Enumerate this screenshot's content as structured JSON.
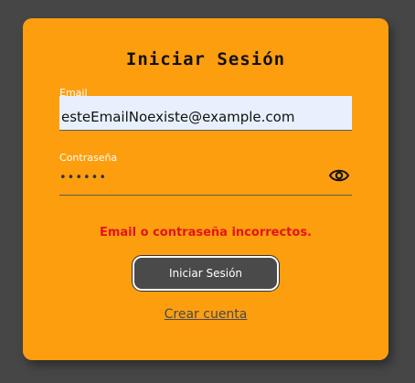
{
  "form": {
    "title": "Iniciar Sesión",
    "email_label": "Email",
    "email_value": "esteEmailNoexiste@example.com",
    "password_label": "Contraseña",
    "password_value": "••••••",
    "show_password_icon": "eye-icon",
    "error_message": "Email o contraseña incorrectos.",
    "submit_label": "Iniciar Sesión",
    "create_account_label": "Crear cuenta"
  },
  "colors": {
    "background": "#464646",
    "card": "#fd9e0e",
    "email_field": "#e8f0fe",
    "error": "#e2141a",
    "button": "#4a4a4a"
  }
}
